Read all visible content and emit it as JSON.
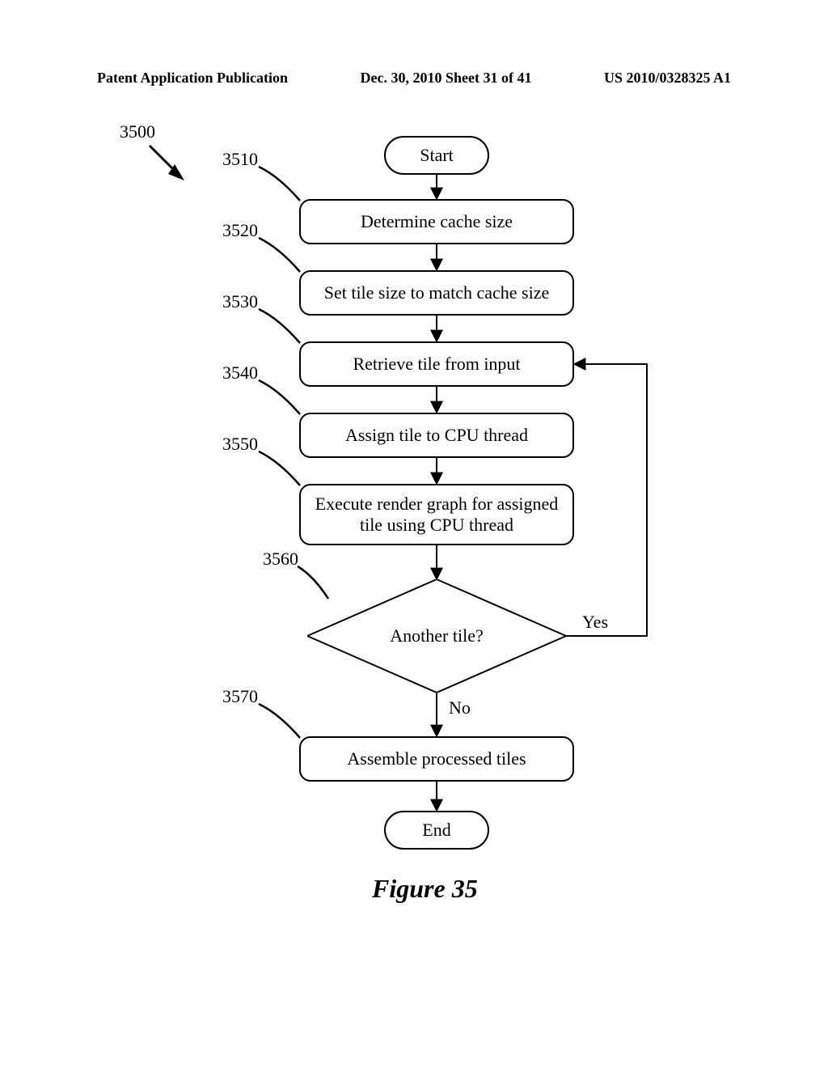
{
  "header": {
    "left": "Patent Application Publication",
    "center": "Dec. 30, 2010  Sheet 31 of 41",
    "right": "US 2010/0328325 A1"
  },
  "figure": {
    "caption": "Figure 35",
    "pointer_ref": "3500",
    "start": "Start",
    "end": "End",
    "steps": [
      {
        "ref": "3510",
        "text": "Determine cache size"
      },
      {
        "ref": "3520",
        "text": "Set tile size to match cache size"
      },
      {
        "ref": "3530",
        "text": "Retrieve tile from input"
      },
      {
        "ref": "3540",
        "text": "Assign tile to CPU thread"
      },
      {
        "ref": "3550",
        "text": "Execute render graph for assigned tile using CPU thread"
      },
      {
        "ref": "3560",
        "text": "Another tile?"
      },
      {
        "ref": "3570",
        "text": "Assemble processed tiles"
      }
    ],
    "decision_yes": "Yes",
    "decision_no": "No"
  }
}
